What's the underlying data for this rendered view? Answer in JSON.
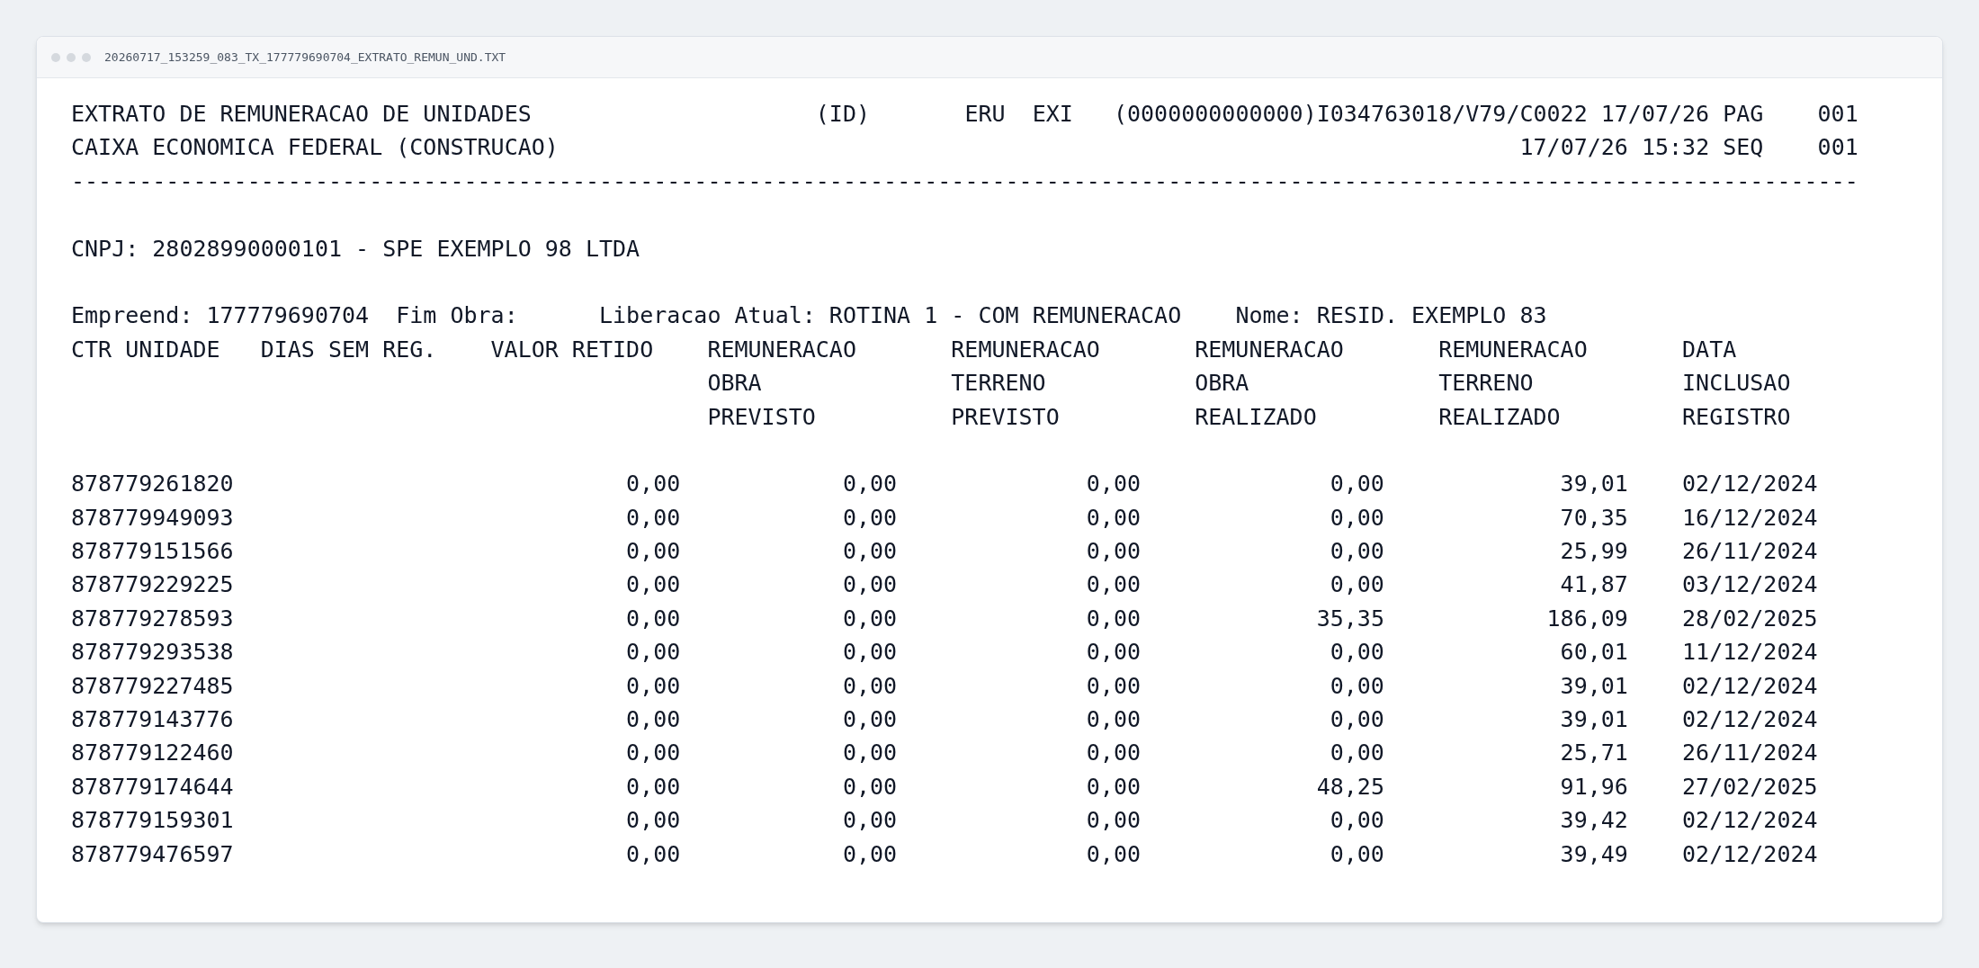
{
  "window": {
    "title": "20260717_153259_083_TX_177779690704_EXTRATO_REMUN_UND.TXT"
  },
  "header": {
    "title": "EXTRATO DE REMUNERACAO DE UNIDADES",
    "id_label": "(ID)",
    "system": "ERU",
    "type": "EXI",
    "reference": "(0000000000000)I034763018/V79/C0022",
    "date": "17/07/26",
    "page_label": "PAG",
    "page": "001",
    "subtitle": "CAIXA ECONOMICA FEDERAL (CONSTRUCAO)",
    "timestamp": "17/07/26 15:32",
    "seq_label": "SEQ",
    "seq": "001"
  },
  "separator": "------------------------------------------------------------------------------------------------------------------------------------",
  "cnpj": "CNPJ: 28028990000101 - SPE EXEMPLO 98 LTDA",
  "info": {
    "empreend": "Empreend: 177779690704",
    "fim_obra": "Fim Obra:",
    "liberacao": "Liberacao Atual: ROTINA 1 - COM REMUNERACAO",
    "nome": "Nome: RESID. EXEMPLO 83"
  },
  "table": {
    "columns": [
      {
        "lines": [
          "CTR UNIDADE"
        ]
      },
      {
        "lines": [
          "DIAS SEM REG."
        ]
      },
      {
        "lines": [
          "VALOR RETIDO"
        ]
      },
      {
        "lines": [
          "REMUNERACAO",
          "OBRA",
          "PREVISTO"
        ]
      },
      {
        "lines": [
          "REMUNERACAO",
          "TERRENO",
          "PREVISTO"
        ]
      },
      {
        "lines": [
          "REMUNERACAO",
          "OBRA",
          "REALIZADO"
        ]
      },
      {
        "lines": [
          "REMUNERACAO",
          "TERRENO",
          "REALIZADO"
        ]
      },
      {
        "lines": [
          "DATA",
          "INCLUSAO",
          "REGISTRO"
        ]
      }
    ],
    "rows": [
      [
        "878779261820",
        "0,00",
        "0,00",
        "0,00",
        "0,00",
        "39,01",
        "02/12/2024"
      ],
      [
        "878779949093",
        "0,00",
        "0,00",
        "0,00",
        "0,00",
        "70,35",
        "16/12/2024"
      ],
      [
        "878779151566",
        "0,00",
        "0,00",
        "0,00",
        "0,00",
        "25,99",
        "26/11/2024"
      ],
      [
        "878779229225",
        "0,00",
        "0,00",
        "0,00",
        "0,00",
        "41,87",
        "03/12/2024"
      ],
      [
        "878779278593",
        "0,00",
        "0,00",
        "0,00",
        "35,35",
        "186,09",
        "28/02/2025"
      ],
      [
        "878779293538",
        "0,00",
        "0,00",
        "0,00",
        "0,00",
        "60,01",
        "11/12/2024"
      ],
      [
        "878779227485",
        "0,00",
        "0,00",
        "0,00",
        "0,00",
        "39,01",
        "02/12/2024"
      ],
      [
        "878779143776",
        "0,00",
        "0,00",
        "0,00",
        "0,00",
        "39,01",
        "02/12/2024"
      ],
      [
        "878779122460",
        "0,00",
        "0,00",
        "0,00",
        "0,00",
        "25,71",
        "26/11/2024"
      ],
      [
        "878779174644",
        "0,00",
        "0,00",
        "0,00",
        "48,25",
        "91,96",
        "27/02/2025"
      ],
      [
        "878779159301",
        "0,00",
        "0,00",
        "0,00",
        "0,00",
        "39,42",
        "02/12/2024"
      ],
      [
        "878779476597",
        "0,00",
        "0,00",
        "0,00",
        "0,00",
        "39,49",
        "02/12/2024"
      ]
    ]
  }
}
